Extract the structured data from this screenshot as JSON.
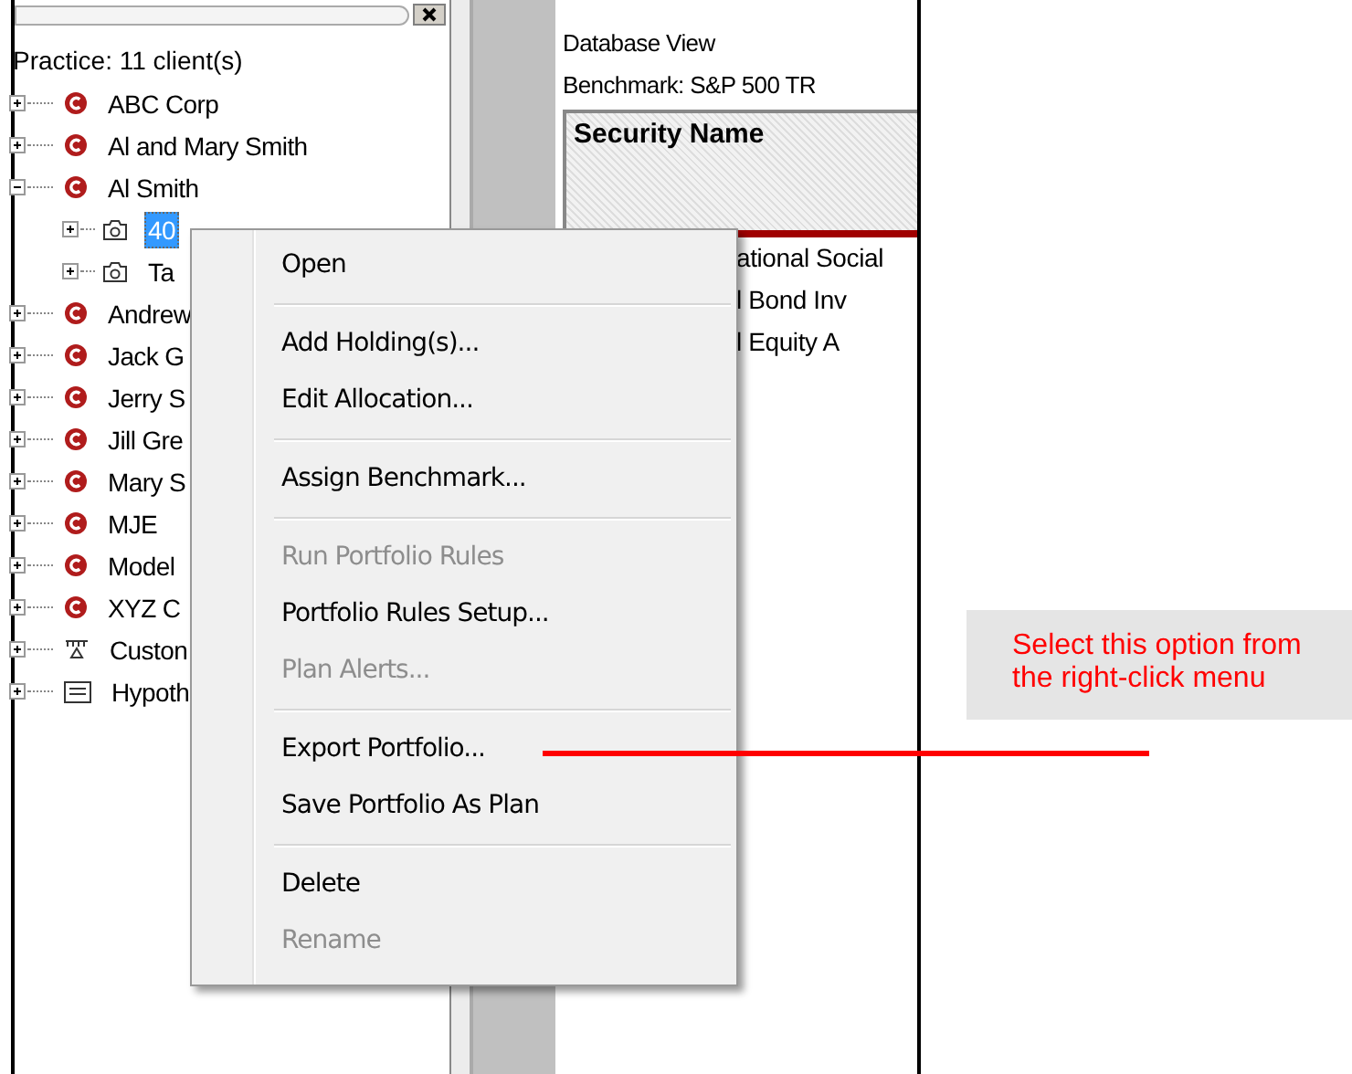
{
  "tree": {
    "root_label": "Practice: 11 client(s)",
    "items": [
      {
        "label": "ABC Corp",
        "kind": "client",
        "expanded": false,
        "selected": false
      },
      {
        "label": "Al and Mary Smith",
        "kind": "client",
        "expanded": false,
        "selected": false
      },
      {
        "label": "Al Smith",
        "kind": "client",
        "expanded": true,
        "selected": false,
        "children": [
          {
            "label": "40",
            "kind": "portfolio",
            "expanded": false,
            "selected": true
          },
          {
            "label": "Ta",
            "kind": "portfolio",
            "expanded": false,
            "selected": false
          }
        ]
      },
      {
        "label": "Andrew",
        "kind": "client",
        "expanded": false,
        "selected": false
      },
      {
        "label": "Jack G",
        "kind": "client",
        "expanded": false,
        "selected": false
      },
      {
        "label": "Jerry S",
        "kind": "client",
        "expanded": false,
        "selected": false
      },
      {
        "label": "Jill Gre",
        "kind": "client",
        "expanded": false,
        "selected": false
      },
      {
        "label": "Mary S",
        "kind": "client",
        "expanded": false,
        "selected": false
      },
      {
        "label": "MJE",
        "kind": "client",
        "expanded": false,
        "selected": false
      },
      {
        "label": "Model",
        "kind": "client",
        "expanded": false,
        "selected": false
      },
      {
        "label": "XYZ C",
        "kind": "client",
        "expanded": false,
        "selected": false
      },
      {
        "label": "Custon",
        "kind": "custom",
        "expanded": false,
        "selected": false
      },
      {
        "label": "Hypoth",
        "kind": "hypothetical",
        "expanded": false,
        "selected": false
      }
    ]
  },
  "view": {
    "title": "Database View",
    "benchmark": "Benchmark: S&P 500 TR",
    "column_header": "Security Name",
    "rows": [
      "ational Social",
      "l Bond Inv",
      "l Equity A"
    ]
  },
  "context_menu": [
    {
      "kind": "item",
      "label": "Open",
      "disabled": false
    },
    {
      "kind": "separator"
    },
    {
      "kind": "item",
      "label": "Add Holding(s)...",
      "disabled": false
    },
    {
      "kind": "item",
      "label": "Edit Allocation...",
      "disabled": false
    },
    {
      "kind": "separator"
    },
    {
      "kind": "item",
      "label": "Assign Benchmark...",
      "disabled": false
    },
    {
      "kind": "separator"
    },
    {
      "kind": "item",
      "label": "Run Portfolio Rules",
      "disabled": true
    },
    {
      "kind": "item",
      "label": "Portfolio Rules Setup...",
      "disabled": false
    },
    {
      "kind": "item",
      "label": "Plan Alerts...",
      "disabled": true
    },
    {
      "kind": "separator"
    },
    {
      "kind": "item",
      "label": "Export Portfolio...",
      "disabled": false
    },
    {
      "kind": "item",
      "label": "Save Portfolio As Plan",
      "disabled": false
    },
    {
      "kind": "separator"
    },
    {
      "kind": "item",
      "label": "Delete",
      "disabled": false
    },
    {
      "kind": "item",
      "label": "Rename",
      "disabled": true
    }
  ],
  "callout": {
    "text": "Select this option from the right-click menu"
  }
}
